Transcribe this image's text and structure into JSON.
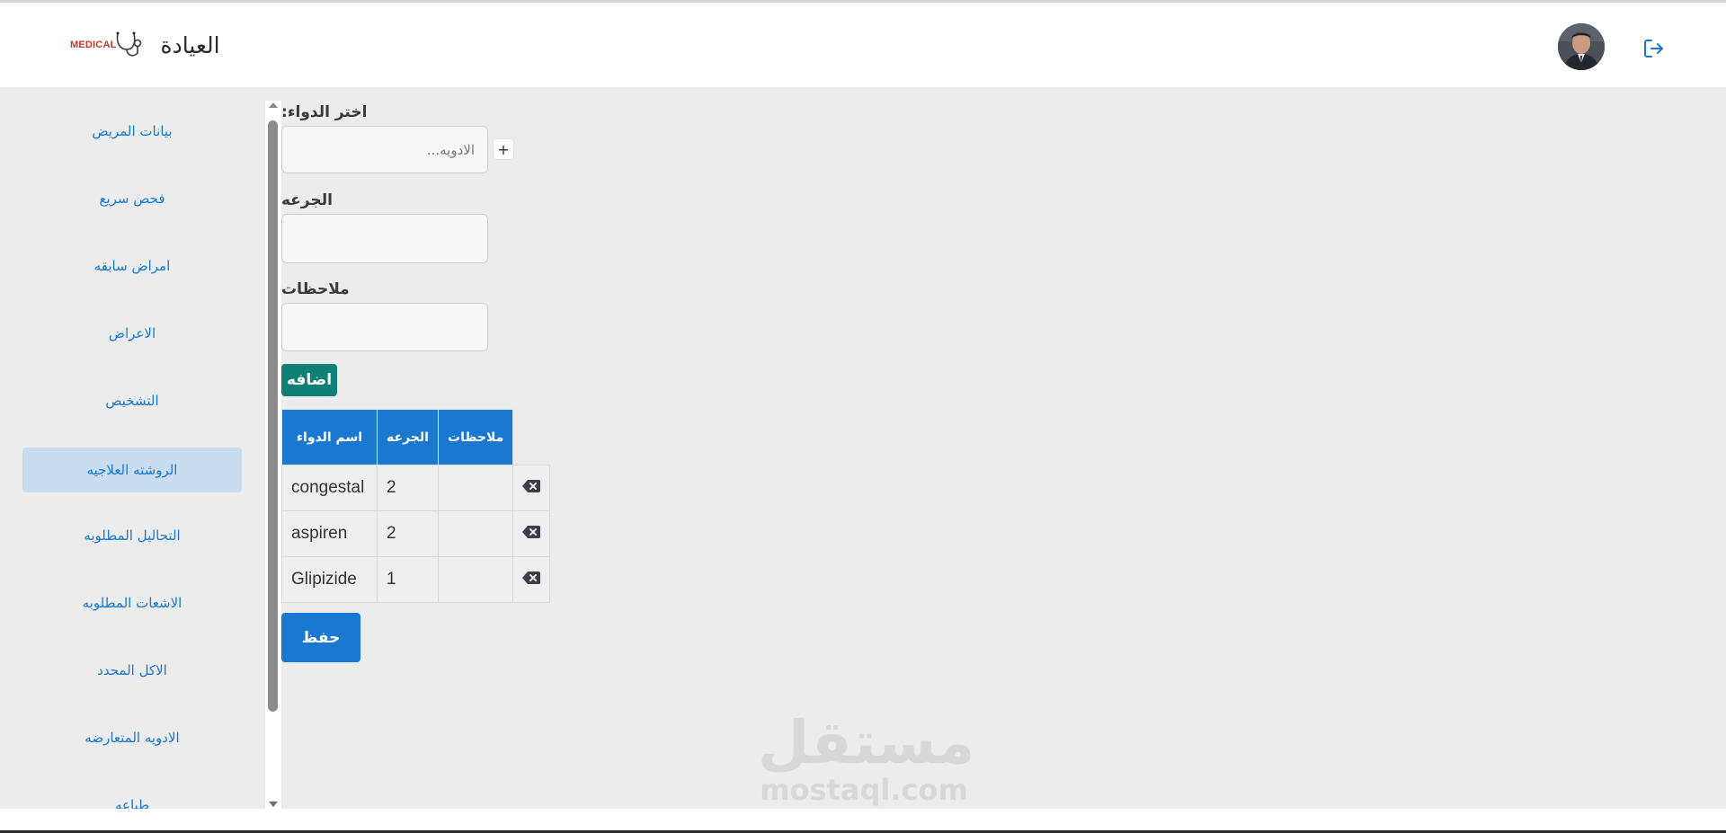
{
  "header": {
    "app_title": "العيادة",
    "logo_text": "MEDICAL",
    "logo_icon": "stethoscope-icon",
    "avatar_icon": "user-avatar",
    "logout_icon": "logout-icon"
  },
  "sidebar": {
    "items": [
      {
        "label": "بيانات المريض",
        "active": false
      },
      {
        "label": "فحص سريع",
        "active": false
      },
      {
        "label": "امراض سابقه",
        "active": false
      },
      {
        "label": "الاعراض",
        "active": false
      },
      {
        "label": "التشخيص",
        "active": false
      },
      {
        "label": "الروشته العلاجيه",
        "active": true
      },
      {
        "label": "التحاليل المطلوبه",
        "active": false
      },
      {
        "label": "الاشعات المطلوبه",
        "active": false
      },
      {
        "label": "الاكل المحدد",
        "active": false
      },
      {
        "label": "الادويه المتعارضه",
        "active": false
      },
      {
        "label": "طباعه",
        "active": false
      }
    ]
  },
  "form": {
    "drug_label": ":اختر الدواء",
    "drug_placeholder": "الادويه...",
    "drug_value": "",
    "add_drug_symbol": "+",
    "dose_label": "الجرعه",
    "dose_value": "",
    "notes_label": "ملاحظات",
    "notes_value": "",
    "add_button": "اضافه"
  },
  "table": {
    "headers": {
      "name": "اسم الدواء",
      "dose": "الجرعه",
      "notes": "ملاحظات"
    },
    "rows": [
      {
        "name": "congestal",
        "dose": "2",
        "notes": ""
      },
      {
        "name": "aspiren",
        "dose": "2",
        "notes": ""
      },
      {
        "name": "Glipizide",
        "dose": "1",
        "notes": ""
      }
    ],
    "delete_icon": "backspace-delete-icon"
  },
  "save_button": "حفظ",
  "watermark": {
    "arabic": "مستقل",
    "latin": "mostaql.com"
  },
  "colors": {
    "primary": "#1a78d0",
    "add_button": "#0f8076",
    "active_sidebar": "#c9ddf1",
    "background": "#ececec",
    "logo_red": "#c0392b"
  }
}
